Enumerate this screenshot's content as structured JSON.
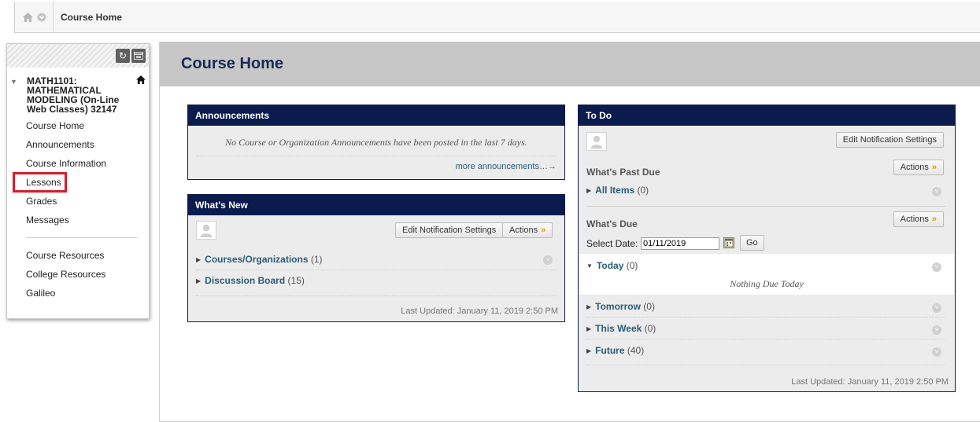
{
  "breadcrumb": {
    "current": "Course Home"
  },
  "sidebar": {
    "course_title": "MATH1101: MATHEMATICAL MODELING (On-Line Web Classes) 32147",
    "items": [
      "Course Home",
      "Announcements",
      "Course Information",
      "Lessons",
      "Grades",
      "Messages"
    ],
    "items2": [
      "Course Resources",
      "College Resources",
      "Galileo"
    ]
  },
  "page": {
    "title": "Course Home"
  },
  "announcements": {
    "title": "Announcements",
    "empty_text": "No Course or Organization Announcements have been posted in the last 7 days.",
    "more_link": "more announcements…→"
  },
  "whats_new": {
    "title": "What's New",
    "edit_button": "Edit Notification Settings",
    "actions_button": "Actions",
    "items": [
      {
        "label": "Courses/Organizations",
        "count": "(1)"
      },
      {
        "label": "Discussion Board",
        "count": "(15)"
      }
    ],
    "last_updated": "Last Updated: January 11, 2019 2:50 PM"
  },
  "todo": {
    "title": "To Do",
    "edit_button": "Edit Notification Settings",
    "past_due_label": "What's Past Due",
    "actions_button": "Actions",
    "past_due_items": [
      {
        "label": "All Items",
        "count": "(0)"
      }
    ],
    "due_label": "What's Due",
    "select_date_label": "Select Date:",
    "date_value": "01/11/2019",
    "go_button": "Go",
    "today": {
      "label": "Today",
      "count": "(0)",
      "empty": "Nothing Due Today"
    },
    "due_items": [
      {
        "label": "Tomorrow",
        "count": "(0)"
      },
      {
        "label": "This Week",
        "count": "(0)"
      },
      {
        "label": "Future",
        "count": "(40)"
      }
    ],
    "last_updated": "Last Updated: January 11, 2019 2:50 PM"
  },
  "colors": {
    "module_header": "#0b1b4e",
    "link": "#2b5c78",
    "highlight_box": "#d41c2a",
    "page_title": "#182a55"
  }
}
